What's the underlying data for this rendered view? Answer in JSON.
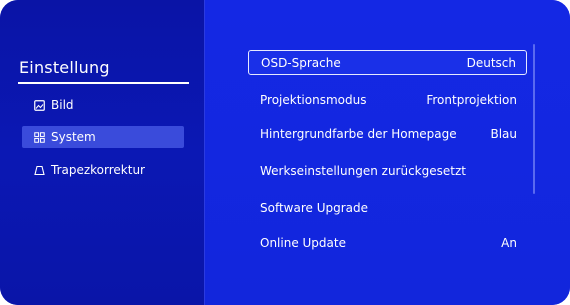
{
  "colors": {
    "sidebar_bg": "#0b18b4",
    "content_bg": "#1428e4",
    "active_item_bg": "#3a4bdb",
    "text": "#ffffff"
  },
  "sidebar": {
    "title": "Einstellung",
    "items": [
      {
        "label": "Bild",
        "icon": "image-icon"
      },
      {
        "label": "System",
        "icon": "grid-icon"
      },
      {
        "label": "Trapezkorrektur",
        "icon": "trapezoid-icon"
      }
    ]
  },
  "settings": [
    {
      "label": "OSD-Sprache",
      "value": "Deutsch"
    },
    {
      "label": "Projektionsmodus",
      "value": "Frontprojektion"
    },
    {
      "label": "Hintergrundfarbe der Homepage",
      "value": "Blau"
    },
    {
      "label": "Werkseinstellungen zurückgesetzt",
      "value": ""
    },
    {
      "label": "Software Upgrade",
      "value": ""
    },
    {
      "label": "Online Update",
      "value": "An"
    }
  ]
}
